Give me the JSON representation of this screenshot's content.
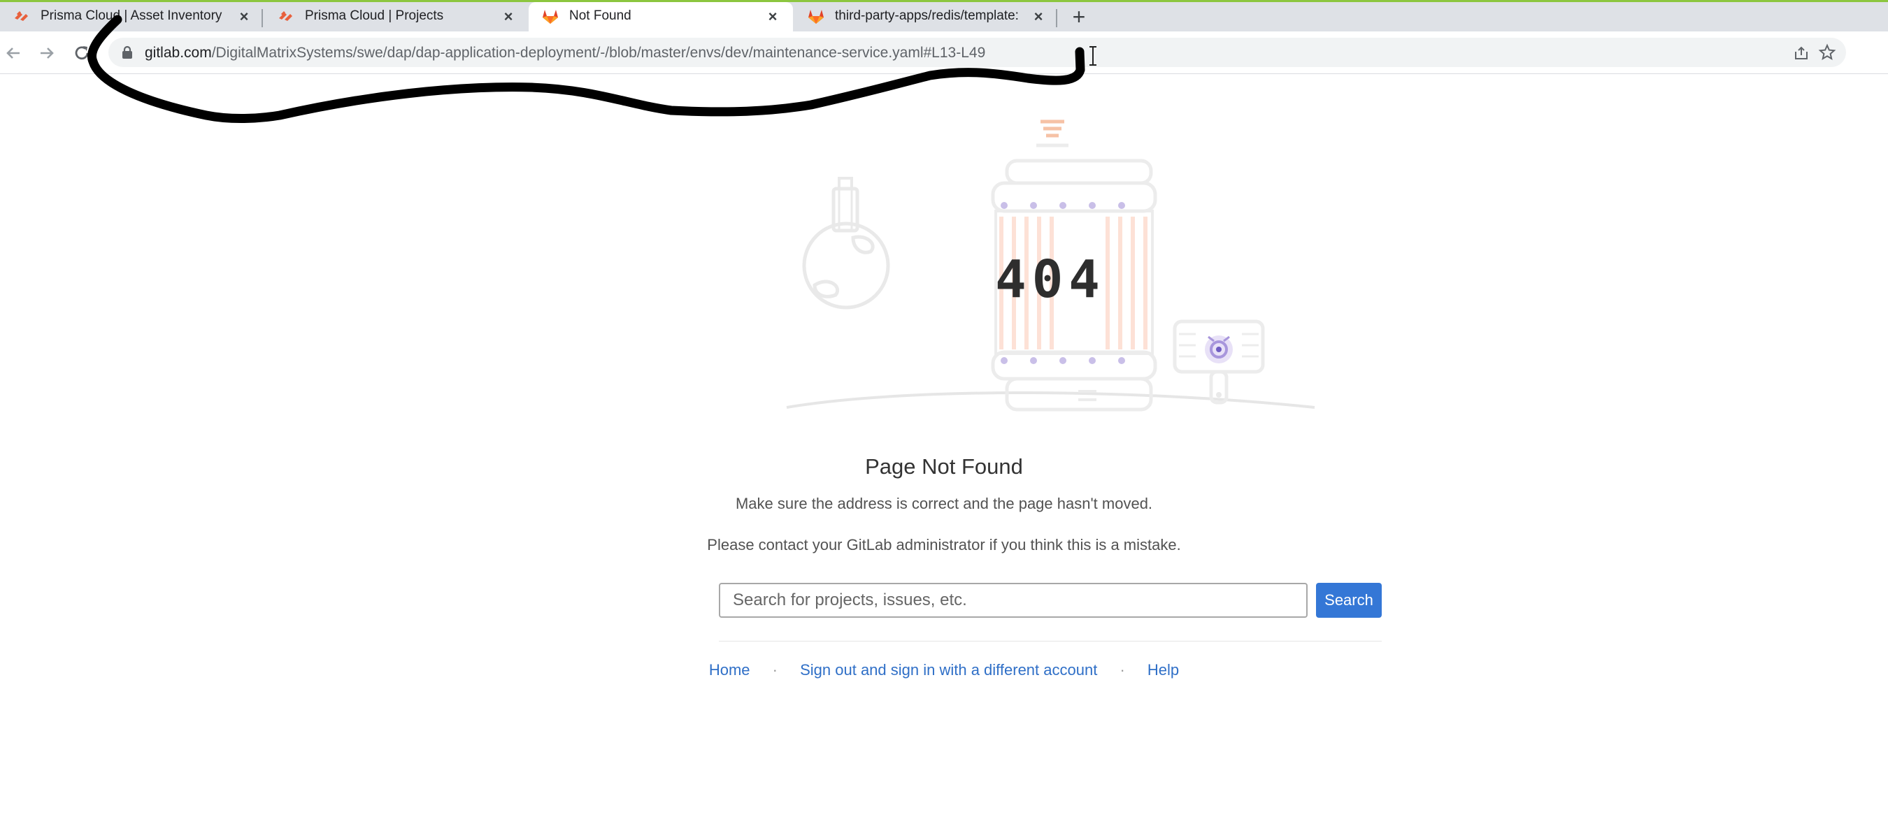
{
  "browser": {
    "tabs": [
      {
        "title": "Prisma Cloud | Asset Inventory",
        "favicon": "prisma-cloud-logo",
        "active": false
      },
      {
        "title": "Prisma Cloud | Projects",
        "favicon": "prisma-cloud-logo",
        "active": false
      },
      {
        "title": "Not Found",
        "favicon": "gitlab-tanuki-logo",
        "active": true
      },
      {
        "title": "third-party-apps/redis/template:",
        "favicon": "gitlab-tanuki-logo",
        "active": false
      }
    ],
    "close_glyph": "×",
    "new_tab_glyph": "+",
    "url_host": "gitlab.com",
    "url_path": "/DigitalMatrixSystems/swe/dap/dap-application-deployment/-/blob/master/envs/dev/maintenance-service.yaml#L13-L49",
    "accent_color": "#8cc63f"
  },
  "page": {
    "error_code": "404",
    "title": "Page Not Found",
    "message_1": "Make sure the address is correct and the page hasn't moved.",
    "message_2": "Please contact your GitLab administrator if you think this is a mistake.",
    "search": {
      "placeholder": "Search for projects, issues, etc.",
      "button_label": "Search",
      "button_color": "#3477d6"
    },
    "footer": {
      "separator": "·",
      "links": [
        "Home",
        "Sign out and sign in with a different account",
        "Help"
      ],
      "link_color": "#2f6fc7"
    }
  }
}
